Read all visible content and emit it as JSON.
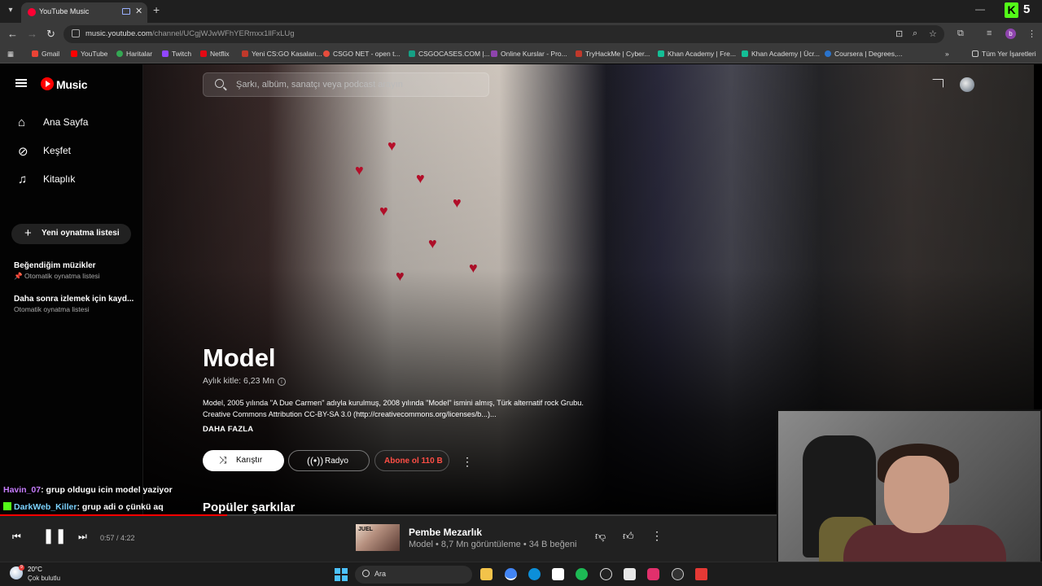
{
  "browser": {
    "tab_title": "YouTube Music",
    "url_host": "music.youtube.com",
    "url_path": "/channel/UCgjWJwWFhYERmxx1llFxLUg",
    "profile_initial": "b",
    "kick_count": "5",
    "kick_badge": "K",
    "bookmarks": [
      "Gmail",
      "YouTube",
      "Haritalar",
      "Twitch",
      "Netflix",
      "Yeni CS:GO Kasaları...",
      "CSGO NET - open t...",
      "CSGOCASES.COM |...",
      "Online Kurslar - Pro...",
      "TryHackMe | Cyber...",
      "Khan Academy | Fre...",
      "Khan Academy | Ücr...",
      "Coursera | Degrees,..."
    ],
    "bookmarks_all": "Tüm Yer İşaretleri"
  },
  "sidebar": {
    "logo_text": "Music",
    "nav": [
      {
        "label": "Ana Sayfa",
        "icon": "home-icon"
      },
      {
        "label": "Keşfet",
        "icon": "compass-icon"
      },
      {
        "label": "Kitaplık",
        "icon": "library-icon"
      }
    ],
    "new_playlist": "Yeni oynatma listesi",
    "playlists": [
      {
        "title": "Beğendiğim müzikler",
        "sub": "Otomatik oynatma listesi",
        "pinned": true
      },
      {
        "title": "Daha sonra izlemek için kayd...",
        "sub": "Otomatik oynatma listesi",
        "pinned": false
      }
    ]
  },
  "search": {
    "placeholder": "Şarkı, albüm, sanatçı veya podcast arayın"
  },
  "artist": {
    "name": "Model",
    "listeners": "Aylık kitle: 6,23 Mn",
    "description": "Model, 2005 yılında \"A Due Carmen\" adıyla kurulmuş, 2008 yılında \"Model\" ismini almış, Türk alternatif rock Grubu. Creative Commons Attribution CC-BY-SA 3.0 (http://creativecommons.org/licenses/b...)...",
    "more": "DAHA FAZLA",
    "shuffle": "Karıştır",
    "radio": "Radyo",
    "subscribe": "Abone ol 110 B",
    "popular_heading": "Popüler şarkılar"
  },
  "chat": [
    {
      "user": "Havin_07",
      "message": ": grup oldugu icin model yaziyor"
    },
    {
      "user": "DarkWeb_Killer",
      "message": ": grup adi o çünkü aq"
    }
  ],
  "player": {
    "time": "0:57 / 4:22",
    "progress": 0.218,
    "title": "Pembe Mezarlık",
    "meta": "Model • 8,7 Mn görüntüleme • 34 B beğeni",
    "thumb_text": "JUEL"
  },
  "taskbar": {
    "temp": "20°C",
    "condition": "Çok bulutlu",
    "search": "Ara",
    "weather_badge": "9"
  },
  "colors": {
    "accent": "#ff0000",
    "subscribe_text": "#ff4e45",
    "kick": "#53fc18"
  }
}
